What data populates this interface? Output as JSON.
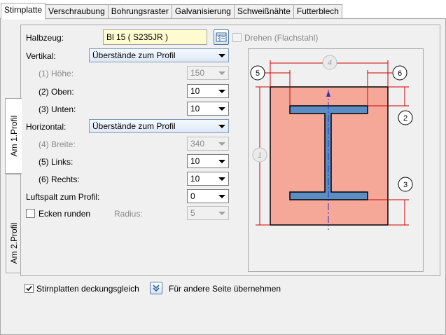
{
  "tabs": [
    "Stirnplatte",
    "Verschraubung",
    "Bohrungsraster",
    "Galvanisierung",
    "Schweißnähte",
    "Futterblech"
  ],
  "side_tabs": [
    "Am 1.Profil",
    "Am 2.Profil"
  ],
  "halbzeug": {
    "label": "Halbzeug:",
    "value": "Bl 15  ( S235JR )"
  },
  "drehen": {
    "label": "Drehen (Flachstahl)"
  },
  "vertikal": {
    "label": "Vertikal:",
    "value": "Überstände zum Profil"
  },
  "hoehe": {
    "label": "(1) Höhe:",
    "value": "150"
  },
  "oben": {
    "label": "(2) Oben:",
    "value": "10"
  },
  "unten": {
    "label": "(3) Unten:",
    "value": "10"
  },
  "horizontal": {
    "label": "Horizontal:",
    "value": "Überstände zum Profil"
  },
  "breite": {
    "label": "(4) Breite:",
    "value": "340"
  },
  "links": {
    "label": "(5) Links:",
    "value": "10"
  },
  "rechts": {
    "label": "(6) Rechts:",
    "value": "10"
  },
  "luftspalt": {
    "label": "Luftspalt zum Profil:",
    "value": "0"
  },
  "ecken": {
    "label": "Ecken runden"
  },
  "radius": {
    "label": "Radius:",
    "value": "5"
  },
  "diagram": {
    "labels": [
      "1",
      "2",
      "3",
      "4",
      "5",
      "6"
    ]
  },
  "bottom": {
    "deckungsgleich": "Stirnplatten deckungsgleich",
    "uebernehmen": "Für andere Seite übernehmen"
  }
}
